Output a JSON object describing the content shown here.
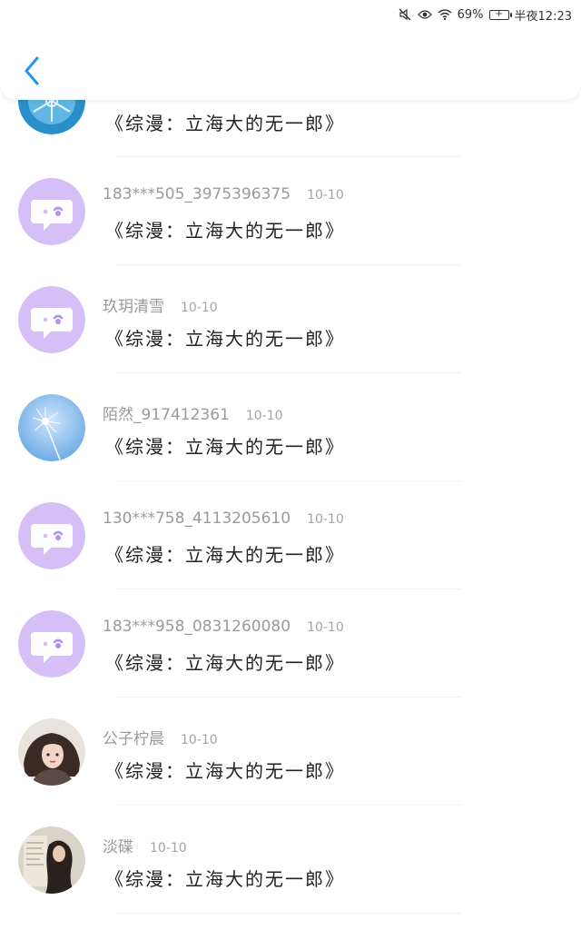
{
  "status_bar": {
    "battery": "69%",
    "time": "半夜12:23",
    "icons": [
      "mute-icon",
      "eye-icon",
      "wifi-icon",
      "battery-icon"
    ]
  },
  "header": {
    "back_icon": "chevron-left-icon",
    "accent_color": "#2196F3"
  },
  "rows": [
    {
      "name": "",
      "date": "",
      "title": "《综漫：立海大的无一郎》",
      "avatar": "snowflake"
    },
    {
      "name": "183***505_3975396375",
      "date": "10-10",
      "title": "《综漫：立海大的无一郎》",
      "avatar": "default"
    },
    {
      "name": "玖玥清雪",
      "date": "10-10",
      "title": "《综漫：立海大的无一郎》",
      "avatar": "default"
    },
    {
      "name": "陌然_917412361",
      "date": "10-10",
      "title": "《综漫：立海大的无一郎》",
      "avatar": "dandelion"
    },
    {
      "name": "130***758_4113205610",
      "date": "10-10",
      "title": "《综漫：立海大的无一郎》",
      "avatar": "default"
    },
    {
      "name": "183***958_0831260080",
      "date": "10-10",
      "title": "《综漫：立海大的无一郎》",
      "avatar": "default"
    },
    {
      "name": "公子柠晨",
      "date": "10-10",
      "title": "《综漫：立海大的无一郎》",
      "avatar": "portrait"
    },
    {
      "name": "淡碟",
      "date": "10-10",
      "title": "《综漫：立海大的无一郎》",
      "avatar": "photo"
    }
  ]
}
